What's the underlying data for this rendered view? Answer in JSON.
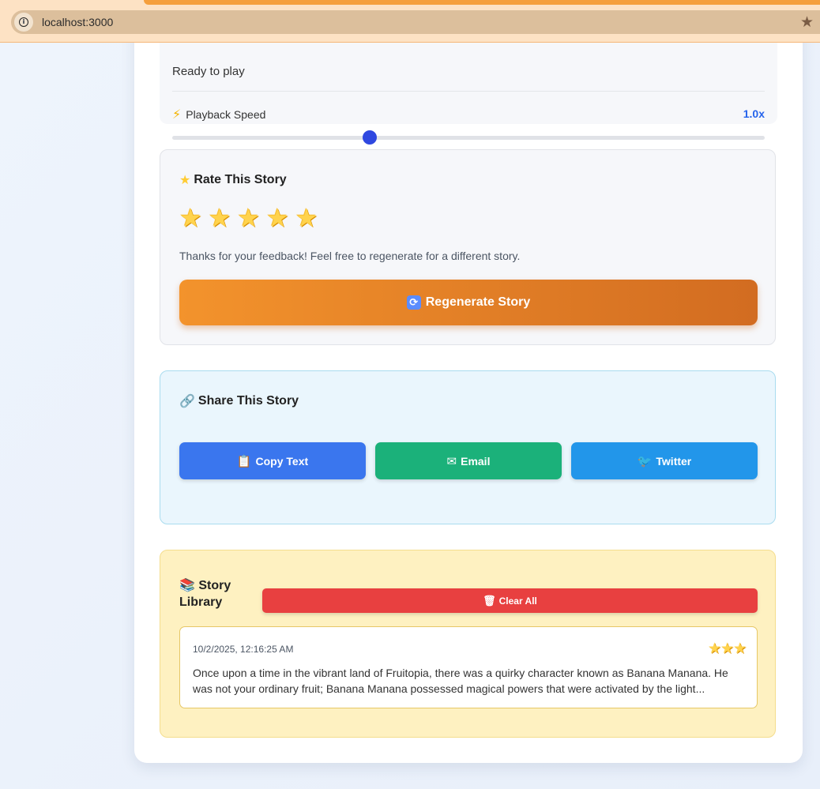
{
  "browser": {
    "url": "localhost:3000"
  },
  "audio": {
    "status": "Ready to play",
    "speed_label": "Playback Speed",
    "speed_value": "1.0x",
    "speed_level": 1.0
  },
  "rate": {
    "title": "Rate This Story",
    "stars": [
      "★",
      "★",
      "★",
      "★",
      "★"
    ],
    "feedback": "Thanks for your feedback! Feel free to regenerate for a different story.",
    "regenerate_label": "Regenerate Story"
  },
  "share": {
    "title": "Share This Story",
    "copy_label": "Copy Text",
    "email_label": "Email",
    "twitter_label": "Twitter"
  },
  "library": {
    "title": "Story Library",
    "clear_label": "Clear All",
    "items": [
      {
        "date": "10/2/2025, 12:16:25 AM",
        "rating": "★★★",
        "text": "Once upon a time in the vibrant land of Fruitopia, there was a quirky character known as Banana Manana. He was not your ordinary fruit; Banana Manana possessed magical powers that were activated by the light..."
      }
    ]
  },
  "colors": {
    "accent_blue": "#2563eb",
    "regenerate_start": "#f3932c",
    "regenerate_end": "#d26c21",
    "copy": "#3a76ee",
    "email": "#1bb17a",
    "twitter": "#2296ea",
    "clear": "#e84040"
  }
}
